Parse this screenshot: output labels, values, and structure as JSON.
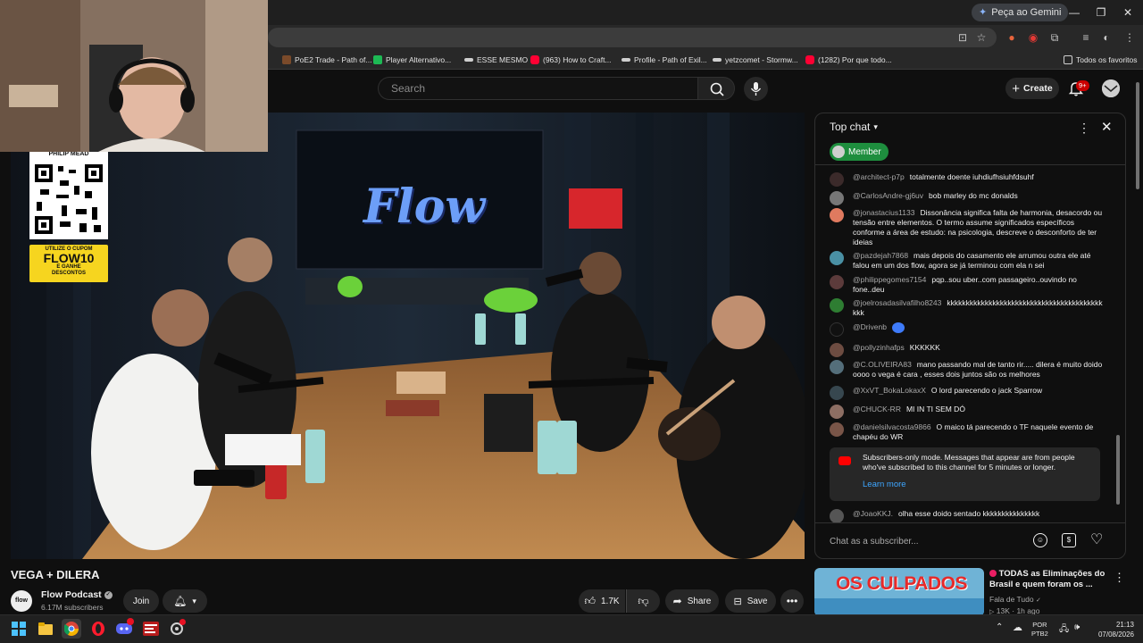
{
  "browser": {
    "gemini_label": "Peça ao Gemini",
    "window_controls": [
      "—",
      "❐",
      "✕"
    ]
  },
  "bookmarks": {
    "items": [
      {
        "label": "PoE2 Trade - Path of...",
        "icon": "poe-icon",
        "color": "#7a4a2a"
      },
      {
        "label": "Player Alternativo...",
        "icon": "green-box-icon",
        "color": "#1db954"
      },
      {
        "label": "ESSE MESMO",
        "icon": "bookmark-icon",
        "color": "#cfcfcf"
      },
      {
        "label": "(963) How to Craft...",
        "icon": "youtube-icon",
        "color": "#ff0033"
      },
      {
        "label": "Profile - Path of Exil...",
        "icon": "bookmark-icon",
        "color": "#cfcfcf"
      },
      {
        "label": "yetzcomet - Stormw...",
        "icon": "bookmark-icon",
        "color": "#cfcfcf"
      },
      {
        "label": "(1282) Por que todo...",
        "icon": "youtube-icon",
        "color": "#ff0033"
      }
    ],
    "all_bookmarks": "Todos os favoritos"
  },
  "youtube": {
    "search_placeholder": "Search",
    "create_label": "Create",
    "notif_badge": "9+"
  },
  "video": {
    "title": "VEGA + DILERA",
    "sponsor_top": "PHILIP MEAD",
    "coupon_line1": "UTILIZE O CUPOM",
    "coupon_code": "FLOW10",
    "coupon_line2": "E GANHE DESCONTOS",
    "logo_text": "Flow"
  },
  "channel": {
    "name": "Flow Podcast",
    "subscribers": "6.17M subscribers",
    "avatar_text": "flow",
    "join_label": "Join"
  },
  "actions": {
    "likes": "1.7K",
    "share": "Share",
    "save": "Save"
  },
  "chat": {
    "mode_label": "Top chat",
    "member_label": "Member",
    "messages": [
      {
        "author": "@architect-p7p",
        "text": "totalmente doente iuhdiufhsiuhfdsuhf",
        "color": "#3b2a2a"
      },
      {
        "author": "@CarlosAndre-gj6uv",
        "text": "bob marley do mc donalds",
        "color": "#777777"
      },
      {
        "author": "@jonastacius1133",
        "text": "Dissonância significa falta de harmonia, desacordo ou tensão entre elementos. O termo assume significados específicos conforme a área de estudo: na psicologia, descreve o desconforto de ter ideias",
        "color": "#e07a5f"
      },
      {
        "author": "@pazdejah7868",
        "text": "mais depois do casamento ele arrumou outra ele até falou em um dos flow, agora se já terminou com ela n sei",
        "color": "#4a90a4"
      },
      {
        "author": "@philippegomes7154",
        "text": "pqp..sou uber..com passageiro..ouvindo no fone..deu",
        "color": "#5c3b3b"
      },
      {
        "author": "@joelrosadasilvafilho8243",
        "text": "kkkkkkkkkkkkkkkkkkkkkkkkkkkkkkkkkkkkkkkkkkkk",
        "color": "#2e7d32"
      },
      {
        "author": "@Drivenb",
        "text": "",
        "color": "#111111"
      },
      {
        "author": "@pollyzinhafps",
        "text": "KKKKKK",
        "color": "#6d4c41"
      },
      {
        "author": "@C.OLIVEIRA83",
        "text": "mano passando mal de tanto rir..... dilera é muito doido oooo o vega é cara , esses dois juntos são os melhores",
        "color": "#546e7a"
      },
      {
        "author": "@XxVT_BokaLokaxX",
        "text": "O lord parecendo o jack Sparrow",
        "color": "#37474f"
      },
      {
        "author": "@CHUCK-RR",
        "text": "MI IN TI SEM DÓ",
        "color": "#8d6e63"
      },
      {
        "author": "@danielsilvacosta9866",
        "text": "O maico tá parecendo o TF naquele evento de chapéu do WR",
        "color": "#795548"
      }
    ],
    "notice_text": "Subscribers-only mode. Messages that appear are from people who've subscribed to this channel for 5 minutes or longer.",
    "learn_more": "Learn more",
    "last_message": {
      "author": "@JoaoKKJ.",
      "text": "olha esse doido sentado kkkkkkkkkkkkkkk",
      "color": "#555555"
    },
    "input_placeholder": "Chat as a subscriber..."
  },
  "recommendation": {
    "thumb_text": "OS CULPADOS",
    "title": "TODAS as Eliminações do Brasil e quem foram os ...",
    "channel": "Fala de Tudo",
    "meta": "13K  ·  1h ago"
  },
  "taskbar": {
    "lang1": "POR",
    "lang2": "PTB2",
    "time": "21:13",
    "date": "07/08/2026"
  },
  "colors": {
    "youtube_red": "#ff0000",
    "member_green": "#1e8e3e",
    "link_blue": "#3ea6ff"
  }
}
